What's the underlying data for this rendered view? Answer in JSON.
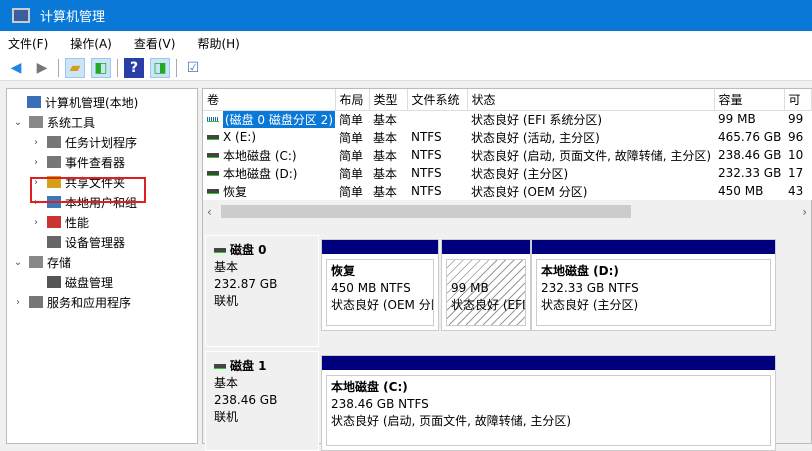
{
  "window": {
    "title": "计算机管理"
  },
  "menu": [
    "文件(F)",
    "操作(A)",
    "查看(V)",
    "帮助(H)"
  ],
  "tree": [
    {
      "label": "计算机管理(本地)",
      "level": 0,
      "exp": ""
    },
    {
      "label": "系统工具",
      "level": 1,
      "exp": "⌄"
    },
    {
      "label": "任务计划程序",
      "level": 2,
      "exp": "›"
    },
    {
      "label": "事件查看器",
      "level": 2,
      "exp": "›"
    },
    {
      "label": "共享文件夹",
      "level": 2,
      "exp": "›"
    },
    {
      "label": "本地用户和组",
      "level": 2,
      "exp": "›"
    },
    {
      "label": "性能",
      "level": 2,
      "exp": "›"
    },
    {
      "label": "设备管理器",
      "level": 2,
      "exp": ""
    },
    {
      "label": "存储",
      "level": 1,
      "exp": "⌄"
    },
    {
      "label": "磁盘管理",
      "level": 2,
      "exp": ""
    },
    {
      "label": "服务和应用程序",
      "level": 1,
      "exp": "›"
    }
  ],
  "table": {
    "headers": [
      "卷",
      "布局",
      "类型",
      "文件系统",
      "状态",
      "容量",
      "可"
    ],
    "rows": [
      [
        "(磁盘 0 磁盘分区 2)",
        "简单",
        "基本",
        "",
        "状态良好 (EFI 系统分区)",
        "99 MB",
        "99"
      ],
      [
        "X (E:)",
        "简单",
        "基本",
        "NTFS",
        "状态良好 (活动, 主分区)",
        "465.76 GB",
        "96"
      ],
      [
        "本地磁盘 (C:)",
        "简单",
        "基本",
        "NTFS",
        "状态良好 (启动, 页面文件, 故障转储, 主分区)",
        "238.46 GB",
        "10"
      ],
      [
        "本地磁盘 (D:)",
        "简单",
        "基本",
        "NTFS",
        "状态良好 (主分区)",
        "232.33 GB",
        "17"
      ],
      [
        "恢复",
        "简单",
        "基本",
        "NTFS",
        "状态良好 (OEM 分区)",
        "450 MB",
        "43"
      ]
    ]
  },
  "disks": [
    {
      "name": "磁盘 0",
      "type": "基本",
      "size": "232.87 GB",
      "status": "联机",
      "parts": [
        {
          "title": "恢复",
          "size": "450 MB NTFS",
          "state": "状态良好 (OEM 分区)"
        },
        {
          "title": "",
          "size": "99 MB",
          "state": "状态良好 (EFI 系统分区)"
        },
        {
          "title": "本地磁盘  (D:)",
          "size": "232.33 GB NTFS",
          "state": "状态良好 (主分区)"
        }
      ]
    },
    {
      "name": "磁盘 1",
      "type": "基本",
      "size": "238.46 GB",
      "status": "联机",
      "parts": [
        {
          "title": "本地磁盘  (C:)",
          "size": "238.46 GB NTFS",
          "state": "状态良好 (启动, 页面文件, 故障转储, 主分区)"
        }
      ]
    }
  ]
}
